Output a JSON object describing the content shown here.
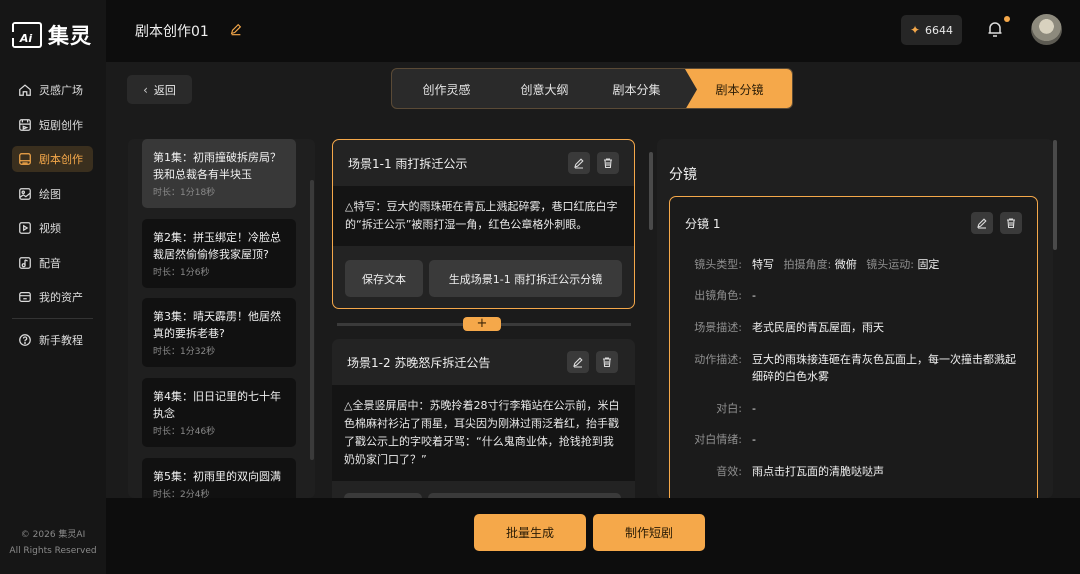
{
  "brand": {
    "logo_mark": "Ai",
    "name": "集灵"
  },
  "sidebar": {
    "items": [
      {
        "label": "灵感广场",
        "icon": "home-icon"
      },
      {
        "label": "短剧创作",
        "icon": "film-icon"
      },
      {
        "label": "剧本创作",
        "icon": "script-icon",
        "active": true
      },
      {
        "label": "绘图",
        "icon": "image-icon"
      },
      {
        "label": "视频",
        "icon": "video-icon"
      },
      {
        "label": "配音",
        "icon": "audio-icon"
      },
      {
        "label": "我的资产",
        "icon": "asset-icon"
      },
      {
        "label": "新手教程",
        "icon": "help-icon"
      }
    ],
    "copyright": "© 2026 集灵AI",
    "rights": "All Rights Reserved"
  },
  "header": {
    "title": "剧本创作01",
    "credits": "6644"
  },
  "nav": {
    "back_label": "返回",
    "steps": [
      "创作灵感",
      "创意大纲",
      "剧本分集",
      "剧本分镜"
    ],
    "active_step": 3
  },
  "episodes": [
    {
      "title": "第1集：初雨撞破拆房局？我和总裁各有半块玉",
      "duration": "时长：1分18秒"
    },
    {
      "title": "第2集：拼玉绑定！冷脸总裁居然偷偷修我家屋顶?",
      "duration": "时长：1分6秒"
    },
    {
      "title": "第3集：晴天霹雳！他居然真的要拆老巷?",
      "duration": "时长：1分32秒"
    },
    {
      "title": "第4集：旧日记里的七十年执念",
      "duration": "时长：1分46秒"
    },
    {
      "title": "第5集：初雨里的双向圆满",
      "duration": "时长：2分4秒"
    }
  ],
  "scenes": [
    {
      "title": "场景1-1 雨打拆迁公示",
      "text": "△特写：豆大的雨珠砸在青瓦上溅起碎雾，巷口红底白字的“拆迁公示”被雨打湿一角，红色公章格外刺眼。",
      "save_label": "保存文本",
      "generate_label": "生成场景1-1 雨打拆迁公示分镜"
    },
    {
      "title": "场景1-2 苏晚怒斥拆迁公告",
      "text": "△全景竖屏居中：苏晚拎着28寸行李箱站在公示前，米白色棉麻衬衫沾了雨星，耳尖因为刚淋过雨泛着红，抬手戳了戳公示上的字咬着牙骂：“什么鬼商业体，抢钱抢到我奶奶家门口了？”"
    }
  ],
  "add_symbol": "+",
  "shots": {
    "heading": "分镜",
    "name": "分镜 1",
    "shot_type_label": "镜头类型:",
    "shot_type": "特写",
    "angle_label": "拍摄角度:",
    "angle": "微俯",
    "motion_label": "镜头运动:",
    "motion": "固定",
    "rows": [
      {
        "label": "出镜角色:",
        "value": "-"
      },
      {
        "label": "场景描述:",
        "value": "老式民居的青瓦屋面，雨天"
      },
      {
        "label": "动作描述:",
        "value": "豆大的雨珠接连砸在青灰色瓦面上，每一次撞击都溅起细碎的白色水雾"
      },
      {
        "label": "对白:",
        "value": "-"
      },
      {
        "label": "对白情绪:",
        "value": "-"
      },
      {
        "label": "音效:",
        "value": "雨点击打瓦面的清脆哒哒声"
      }
    ]
  },
  "actions": {
    "batch_label": "批量生成",
    "make_label": "制作短剧"
  },
  "colors": {
    "accent": "#f5a84a",
    "bg": "#0d0d0d",
    "panel": "#1f1f1f"
  }
}
